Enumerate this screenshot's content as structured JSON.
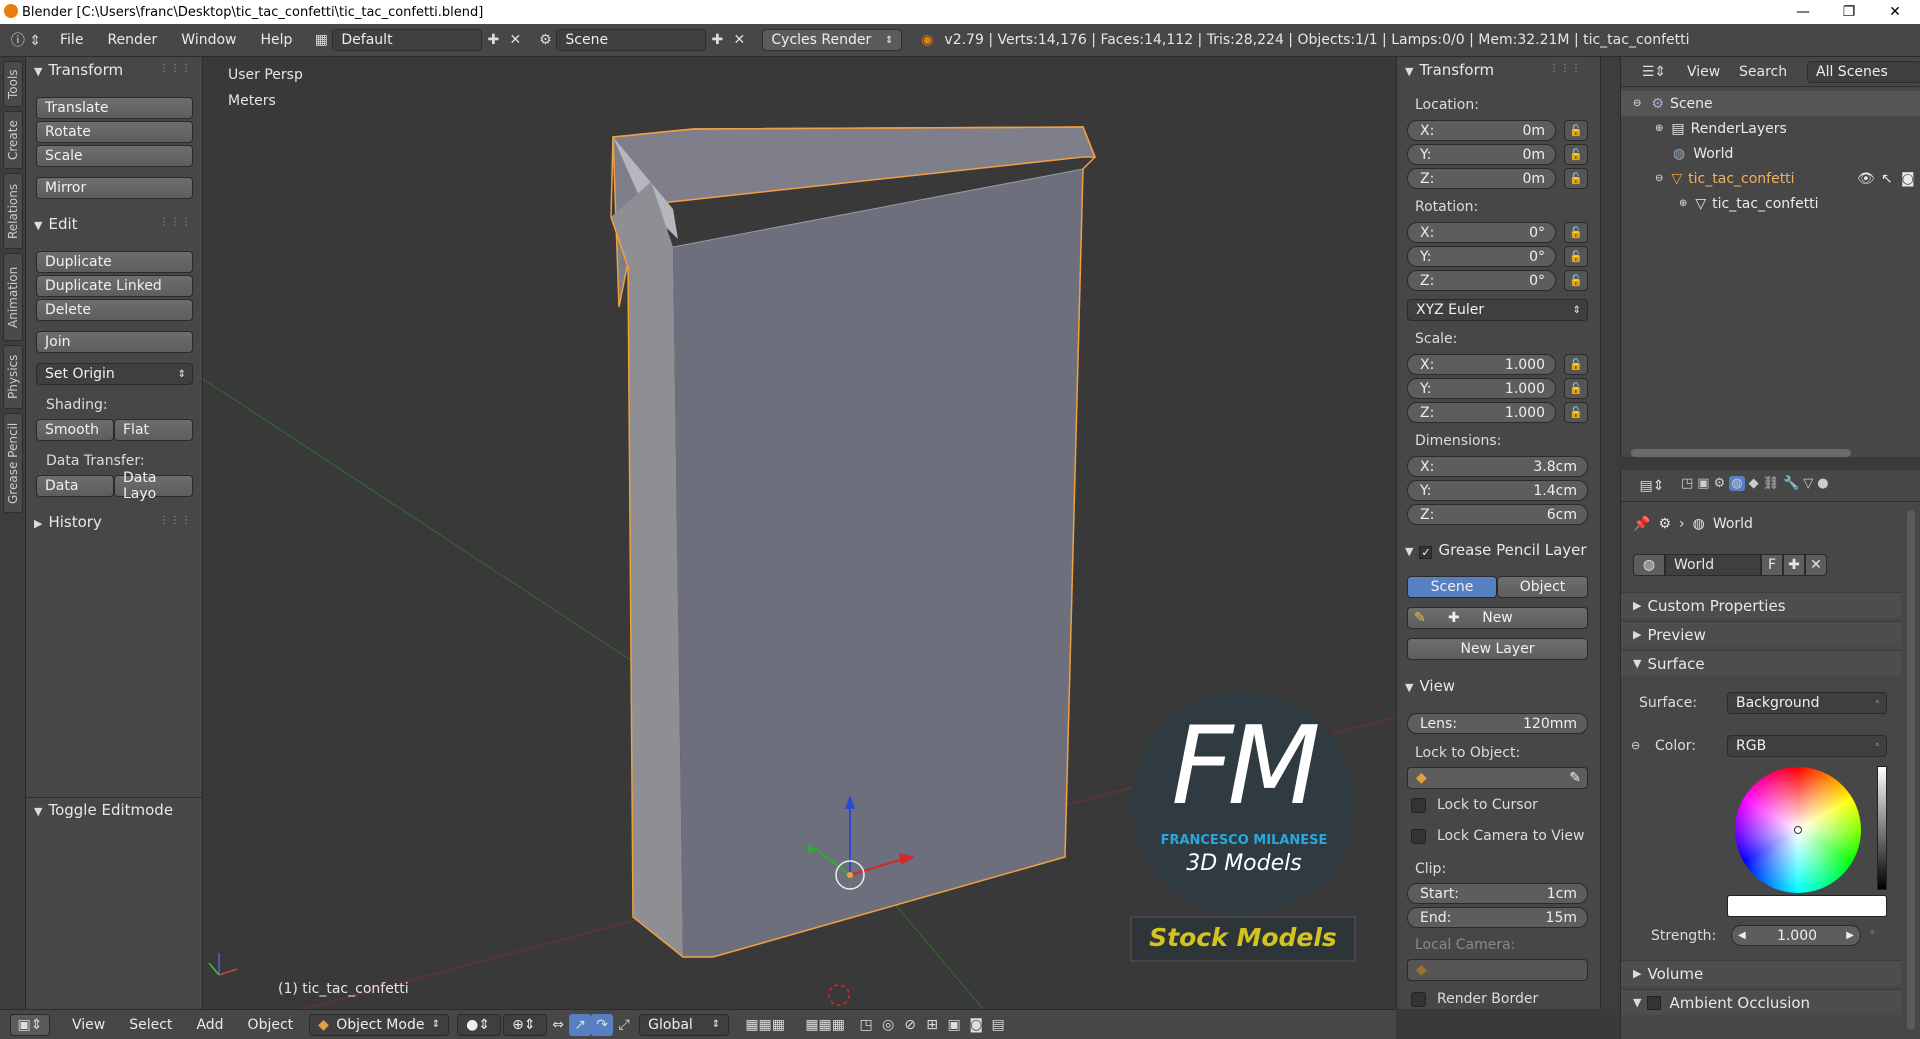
{
  "window": {
    "title": "Blender [C:\\Users\\franc\\Desktop\\tic_tac_confetti\\tic_tac_confetti.blend]",
    "minimize": "—",
    "maximize": "❐",
    "close": "✕"
  },
  "info_header": {
    "menus": [
      "File",
      "Render",
      "Window",
      "Help"
    ],
    "layout": "Default",
    "scene": "Scene",
    "engine": "Cycles Render",
    "stats": "v2.79 | Verts:14,176 | Faces:14,112 | Tris:28,224 | Objects:1/1 | Lamps:0/0 | Mem:32.21M | tic_tac_confetti"
  },
  "tool_tabs": [
    "Tools",
    "Create",
    "Relations",
    "Animation",
    "Physics",
    "Grease Pencil"
  ],
  "toolshelf": {
    "transform_title": "Transform",
    "translate": "Translate",
    "rotate": "Rotate",
    "scale": "Scale",
    "mirror": "Mirror",
    "edit_title": "Edit",
    "duplicate": "Duplicate",
    "duplicate_linked": "Duplicate Linked",
    "delete": "Delete",
    "join": "Join",
    "set_origin": "Set Origin",
    "shading_label": "Shading:",
    "smooth": "Smooth",
    "flat": "Flat",
    "data_transfer_label": "Data Transfer:",
    "data": "Data",
    "data_layout": "Data Layo",
    "history": "History",
    "toggle_editmode": "Toggle Editmode"
  },
  "viewport": {
    "view_name": "User Persp",
    "units": "Meters",
    "object_label": "(1) tic_tac_confetti",
    "watermark_initials": "FM",
    "watermark_name": "FRANCESCO MILANESE",
    "watermark_sub": "3D Models",
    "watermark_banner": "Stock Models"
  },
  "npanel": {
    "transform_title": "Transform",
    "location_label": "Location:",
    "loc": [
      {
        "axis": "X:",
        "value": "0m"
      },
      {
        "axis": "Y:",
        "value": "0m"
      },
      {
        "axis": "Z:",
        "value": "0m"
      }
    ],
    "rotation_label": "Rotation:",
    "rot": [
      {
        "axis": "X:",
        "value": "0°"
      },
      {
        "axis": "Y:",
        "value": "0°"
      },
      {
        "axis": "Z:",
        "value": "0°"
      }
    ],
    "rotation_mode": "XYZ Euler",
    "scale_label": "Scale:",
    "scale": [
      {
        "axis": "X:",
        "value": "1.000"
      },
      {
        "axis": "Y:",
        "value": "1.000"
      },
      {
        "axis": "Z:",
        "value": "1.000"
      }
    ],
    "dimensions_label": "Dimensions:",
    "dim": [
      {
        "axis": "X:",
        "value": "3.8cm"
      },
      {
        "axis": "Y:",
        "value": "1.4cm"
      },
      {
        "axis": "Z:",
        "value": "6cm"
      }
    ],
    "grease_title": "Grease Pencil Layer",
    "gp_scene": "Scene",
    "gp_object": "Object",
    "gp_new": "New",
    "gp_new_layer": "New Layer",
    "view_title": "View",
    "lens_label": "Lens:",
    "lens_value": "120mm",
    "lock_to_object": "Lock to Object:",
    "lock_to_cursor": "Lock to Cursor",
    "lock_camera": "Lock Camera to View",
    "clip_label": "Clip:",
    "clip_start_label": "Start:",
    "clip_start": "1cm",
    "clip_end_label": "End:",
    "clip_end": "15m",
    "local_camera": "Local Camera:",
    "render_border": "Render Border"
  },
  "outliner": {
    "view": "View",
    "search": "Search",
    "filter": "All Scenes",
    "items": [
      "Scene",
      "RenderLayers",
      "World",
      "tic_tac_confetti",
      "tic_tac_confetti"
    ]
  },
  "properties": {
    "breadcrumb": "World",
    "world_name": "World",
    "fake_user": "F",
    "custom_properties": "Custom Properties",
    "preview": "Preview",
    "surface_title": "Surface",
    "surface_label": "Surface:",
    "surface_value": "Background",
    "color_label": "Color:",
    "color_value": "RGB",
    "strength_label": "Strength:",
    "strength_value": "1.000",
    "volume": "Volume",
    "ambient_occlusion": "Ambient Occlusion"
  },
  "bottom_header": {
    "menus": [
      "View",
      "Select",
      "Add",
      "Object"
    ],
    "mode": "Object Mode",
    "orientation": "Global"
  },
  "colors": {
    "accent_blue": "#5680c2",
    "selection_orange": "#f0a040",
    "watermark_blue": "#29a8e0",
    "banner_yellow": "#d4c31e"
  }
}
